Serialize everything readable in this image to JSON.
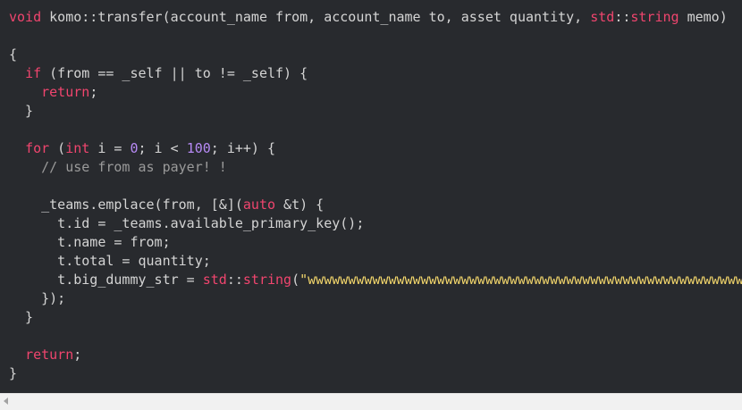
{
  "code": {
    "lines": [
      [
        {
          "t": "void",
          "c": "kw"
        },
        {
          "t": " komo::transfer(account_name from, account_name to, asset quantity, ",
          "c": "plain"
        },
        {
          "t": "std",
          "c": "kw"
        },
        {
          "t": "::",
          "c": "plain"
        },
        {
          "t": "string",
          "c": "kw"
        },
        {
          "t": " memo)",
          "c": "plain"
        }
      ],
      [],
      [
        {
          "t": "{",
          "c": "plain"
        }
      ],
      [
        {
          "t": "  ",
          "c": "plain"
        },
        {
          "t": "if",
          "c": "kw"
        },
        {
          "t": " (from == _self || to != _self) {",
          "c": "plain"
        }
      ],
      [
        {
          "t": "    ",
          "c": "plain"
        },
        {
          "t": "return",
          "c": "kw"
        },
        {
          "t": ";",
          "c": "plain"
        }
      ],
      [
        {
          "t": "  }",
          "c": "plain"
        }
      ],
      [],
      [
        {
          "t": "  ",
          "c": "plain"
        },
        {
          "t": "for",
          "c": "kw"
        },
        {
          "t": " (",
          "c": "plain"
        },
        {
          "t": "int",
          "c": "kw"
        },
        {
          "t": " i = ",
          "c": "plain"
        },
        {
          "t": "0",
          "c": "num"
        },
        {
          "t": "; i < ",
          "c": "plain"
        },
        {
          "t": "100",
          "c": "num"
        },
        {
          "t": "; i++) {",
          "c": "plain"
        }
      ],
      [
        {
          "t": "    ",
          "c": "plain"
        },
        {
          "t": "// use from as payer! !",
          "c": "cmt"
        }
      ],
      [],
      [
        {
          "t": "    _teams.emplace(from, [&](",
          "c": "plain"
        },
        {
          "t": "auto",
          "c": "kw"
        },
        {
          "t": " &t) {",
          "c": "plain"
        }
      ],
      [
        {
          "t": "      t.id = _teams.available_primary_key();",
          "c": "plain"
        }
      ],
      [
        {
          "t": "      t.name = from;",
          "c": "plain"
        }
      ],
      [
        {
          "t": "      t.total = quantity;",
          "c": "plain"
        }
      ],
      [
        {
          "t": "      t.big_dummy_str = ",
          "c": "plain"
        },
        {
          "t": "std",
          "c": "kw"
        },
        {
          "t": "::",
          "c": "plain"
        },
        {
          "t": "string",
          "c": "kw"
        },
        {
          "t": "(",
          "c": "plain"
        },
        {
          "t": "\"wwwwwwwwwwwwwwwwwwwwwwwwwwwwwwwwwwwwwwwwwwwwwwwwwwwwwwwwwwwwwwwwwwwwwwwwwwwwwwww",
          "c": "str"
        }
      ],
      [
        {
          "t": "    });",
          "c": "plain"
        }
      ],
      [
        {
          "t": "  }",
          "c": "plain"
        }
      ],
      [],
      [
        {
          "t": "  ",
          "c": "plain"
        },
        {
          "t": "return",
          "c": "kw"
        },
        {
          "t": ";",
          "c": "plain"
        }
      ],
      [
        {
          "t": "}",
          "c": "plain"
        }
      ]
    ]
  },
  "scrollbar": {
    "left_arrow_icon": "triangle-left"
  }
}
